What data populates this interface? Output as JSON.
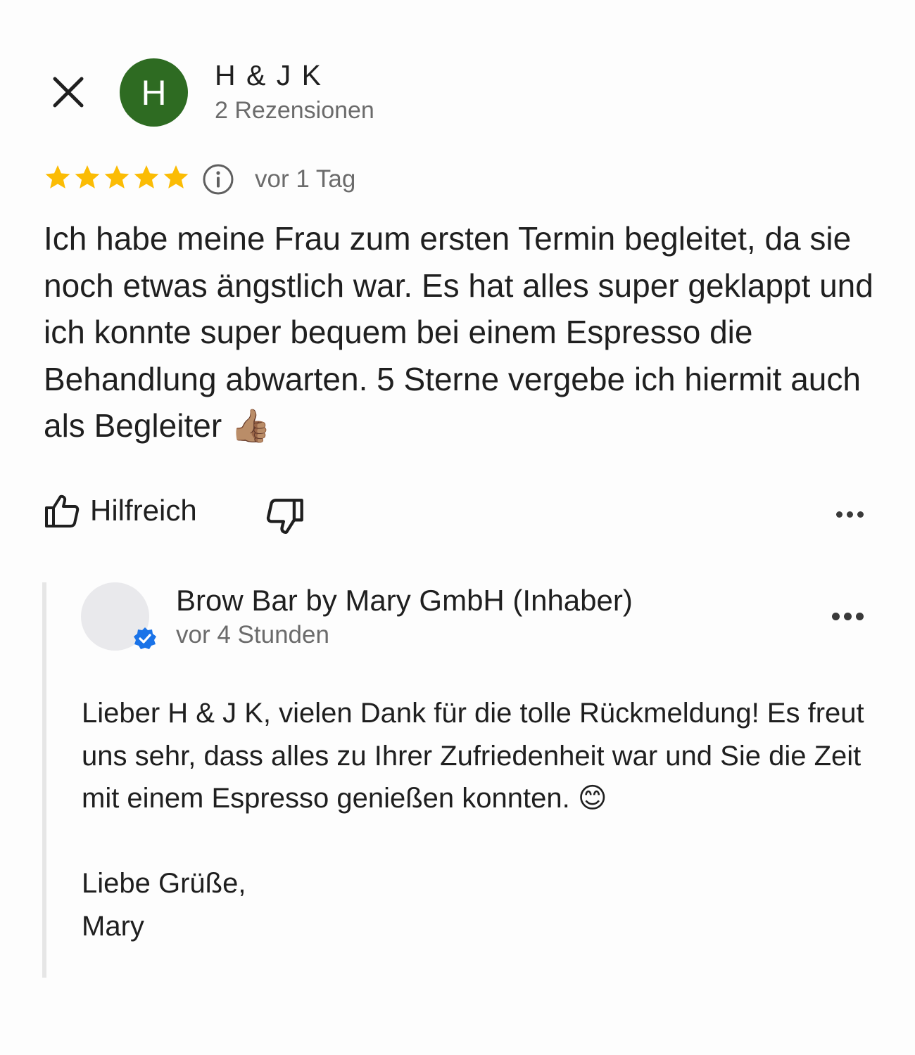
{
  "header": {
    "close_icon": "close-icon",
    "avatar_initial": "H",
    "avatar_color": "#2e6b22",
    "reviewer_name": "H & J K",
    "review_count": "2 Rezensionen"
  },
  "review": {
    "rating": 5,
    "rating_max": 5,
    "star_color": "#fbbc04",
    "date": "vor 1 Tag",
    "text": "Ich habe meine Frau zum ersten Termin begleitet, da sie noch etwas ängstlich war. Es hat alles super geklappt und ich konnte super bequem bei einem Espresso die Behandlung abwarten. 5 Sterne vergebe ich hiermit auch als Begleiter",
    "emoji": "👍🏽"
  },
  "actions": {
    "helpful_label": "Hilfreich",
    "thumbs_up_icon": "thumbs-up-icon",
    "thumbs_down_icon": "thumbs-down-icon",
    "more_icon": "more-horizontal-icon"
  },
  "owner_reply": {
    "name": "Brow Bar by Mary GmbH (Inhaber)",
    "date": "vor 4 Stunden",
    "verified_color": "#1a73e8",
    "text": "Lieber H & J K, vielen Dank für die tolle Rückmeldung! Es freut uns sehr, dass alles zu Ihrer Zufriedenheit war und Sie die Zeit mit einem Espresso genießen konnten.",
    "emoji": "😊",
    "greeting_line1": "Liebe Grüße,",
    "greeting_line2": "Mary"
  }
}
